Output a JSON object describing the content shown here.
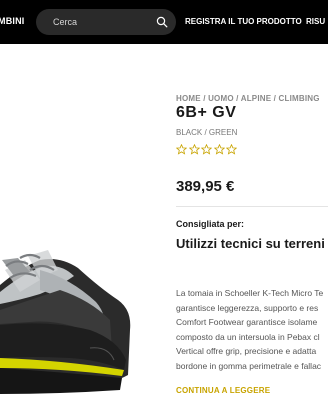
{
  "header": {
    "nav_left": "MBINI",
    "search_placeholder": "Cerca",
    "register_link": "REGISTRA IL TUO PRODOTTO",
    "nav_right": "RISU"
  },
  "product": {
    "breadcrumb": "HOME / UOMO / ALPINE / CLIMBING",
    "title": "6B+ GV",
    "color": "BLACK / GREEN",
    "rating": {
      "value": 0,
      "max": 5
    },
    "price": "389,95 €",
    "recommended_label": "Consigliata per:",
    "recommended_value": "Utilizzi tecnici su terreni",
    "description_lines": [
      "La tomaia in Schoeller K-Tech Micro Te",
      "garantisce leggerezza, supporto e res",
      "Comfort Footwear garantisce isolame",
      "composto da un intersuola in Pebax cl",
      "Vertical offre grip, precisione e adatta",
      "bordone in gomma perimetrale e fallac"
    ],
    "read_more": "CONTINUA A LEGGERE"
  },
  "colors": {
    "accent": "#c8a400",
    "header_bg": "#000000",
    "star_outline": "#c8a400"
  }
}
